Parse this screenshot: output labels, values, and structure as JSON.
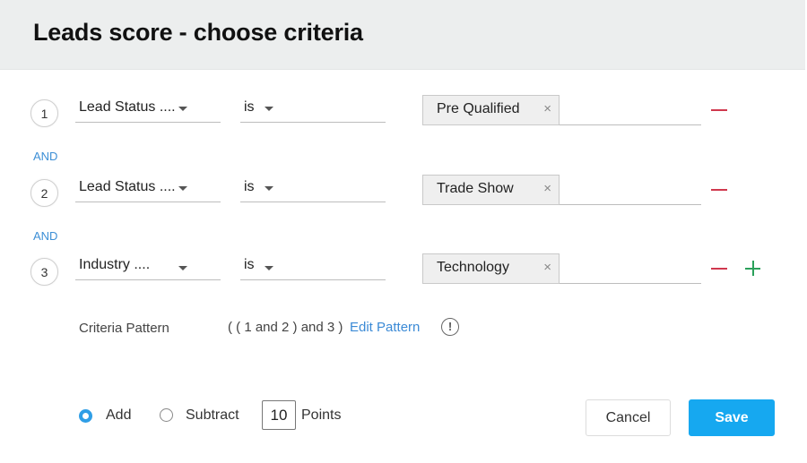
{
  "header": {
    "title": "Leads score - choose criteria"
  },
  "criteria": [
    {
      "number": "1",
      "field": "Lead Status ....",
      "operator": "is",
      "value": "Pre Qualified",
      "remove_icon": "minus-icon"
    },
    {
      "number": "2",
      "field": "Lead Status ....",
      "operator": "is",
      "value": "Trade Show",
      "remove_icon": "minus-icon"
    },
    {
      "number": "3",
      "field": "Industry ....",
      "operator": "is",
      "value": "Technology",
      "remove_icon": "minus-icon",
      "add_icon": "plus-icon"
    }
  ],
  "connectors": [
    "AND",
    "AND"
  ],
  "chip_remove_glyph": "×",
  "pattern": {
    "label": "Criteria Pattern",
    "value": "( ( 1 and 2 ) and 3 )",
    "edit_label": "Edit Pattern",
    "info_glyph": "!"
  },
  "scoring": {
    "options": [
      {
        "label": "Add",
        "selected": true
      },
      {
        "label": "Subtract",
        "selected": false
      }
    ],
    "points_value": "10",
    "points_label": "Points"
  },
  "actions": {
    "cancel_label": "Cancel",
    "save_label": "Save"
  },
  "colors": {
    "accent": "#16a8f0",
    "link": "#3b8ad6",
    "remove": "#d0384e",
    "add": "#2aa05a",
    "header_bg": "#eceeee"
  }
}
